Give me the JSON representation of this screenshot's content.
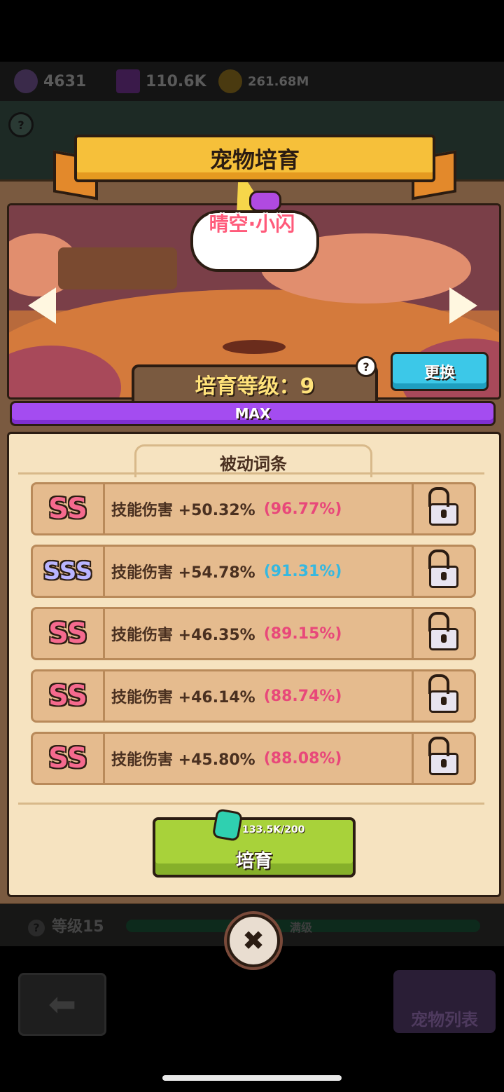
{
  "resources": {
    "gems": "4631",
    "crystals": "110.6K",
    "coins": "261.68M"
  },
  "panel": {
    "title": "宠物培育",
    "pet_name": "晴空·小闪",
    "breed_level_label": "培育等级：9",
    "help_symbol": "?",
    "swap_button": "更换",
    "progress_text": "MAX"
  },
  "passive": {
    "header": "被动词条",
    "rows": [
      {
        "grade": "SS",
        "text": "技能伤害 +50.32%",
        "pct": "(96.77%)",
        "pct_color": "#e8487a"
      },
      {
        "grade": "SSS",
        "text": "技能伤害 +54.78%",
        "pct": "(91.31%)",
        "pct_color": "#35b8e0"
      },
      {
        "grade": "SS",
        "text": "技能伤害 +46.35%",
        "pct": "(89.15%)",
        "pct_color": "#e8487a"
      },
      {
        "grade": "SS",
        "text": "技能伤害 +46.14%",
        "pct": "(88.74%)",
        "pct_color": "#e8487a"
      },
      {
        "grade": "SS",
        "text": "技能伤害 +45.80%",
        "pct": "(88.08%)",
        "pct_color": "#e8487a"
      }
    ]
  },
  "breed_button": {
    "label": "培育",
    "cost": "133.5K/200"
  },
  "background": {
    "level_label": "等级15",
    "max_label": "满级",
    "pet_list": "宠物列表"
  },
  "close_symbol": "✖"
}
